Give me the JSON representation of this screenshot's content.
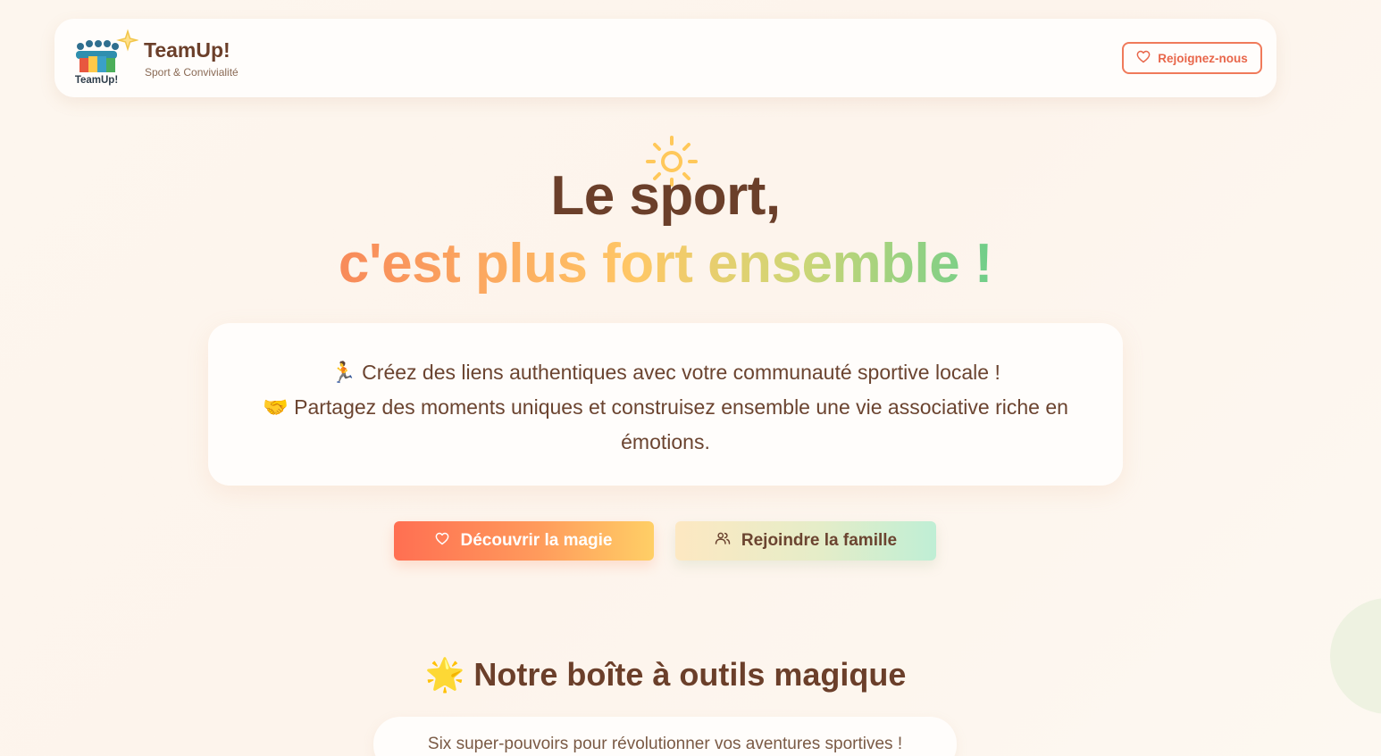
{
  "header": {
    "brand_title": "TeamUp!",
    "brand_subtitle": "Sport & Convivialité",
    "logo_text": "TeamUp!",
    "join_button": "Rejoignez-nous"
  },
  "hero": {
    "line1": "Le sport,",
    "line2": "c'est plus fort ensemble !",
    "intro_line1": "🏃 Créez des liens authentiques avec votre communauté sportive locale !",
    "intro_line2": "🤝 Partagez des moments uniques et construisez ensemble une vie associative riche en émotions.",
    "cta_primary": "Découvrir la magie",
    "cta_secondary": "Rejoindre la famille"
  },
  "tools_section": {
    "icon": "🌟",
    "title": "Notre boîte à outils magique",
    "subtitle": "Six super-pouvoirs pour révolutionner vos aventures sportives !"
  },
  "colors": {
    "brand_brown": "#6b3f2a",
    "accent_coral": "#f07a5a",
    "accent_yellow": "#ffc766",
    "accent_green": "#6fce8a"
  },
  "icons": {
    "join": "heart-icon",
    "cta_primary": "heart-icon",
    "cta_secondary": "users-icon",
    "hero_decoration": "sun-icon"
  }
}
